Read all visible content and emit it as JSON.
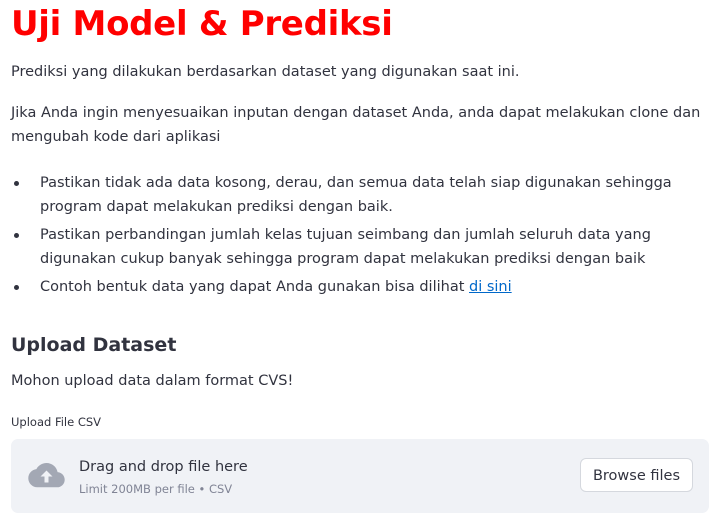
{
  "header": {
    "title": "Uji Model & Prediksi",
    "title_color": "#ff0000"
  },
  "intro": {
    "paragraph1": "Prediksi yang dilakukan berdasarkan dataset yang digunakan saat ini.",
    "paragraph2": "Jika Anda ingin menyesuaikan inputan dengan dataset Anda, anda dapat melakukan clone dan mengubah kode dari aplikasi"
  },
  "bullets": {
    "item1": "Pastikan tidak ada data kosong, derau, dan semua data telah siap digunakan sehingga program dapat melakukan prediksi dengan baik.",
    "item2": "Pastikan perbandingan jumlah kelas tujuan seimbang dan jumlah seluruh data yang digunakan cukup banyak sehingga program dapat melakukan prediksi dengan baik",
    "item3_prefix": "Contoh bentuk data yang dapat Anda gunakan bisa dilihat ",
    "item3_link": "di sini"
  },
  "upload_section": {
    "heading": "Upload Dataset",
    "instruction": "Mohon upload data dalam format CVS!",
    "field_label": "Upload File CSV",
    "dropzone_main": "Drag and drop file here",
    "dropzone_sub": "Limit 200MB per file • CSV",
    "browse_label": "Browse files",
    "icon": "cloud-upload-icon"
  },
  "colors": {
    "text": "#31333f",
    "link": "#0068c9",
    "dropzone_bg": "#f0f2f6",
    "muted": "#808495"
  }
}
